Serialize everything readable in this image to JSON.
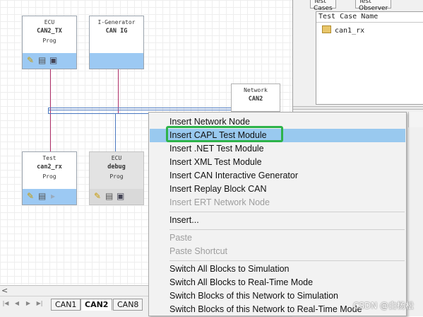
{
  "blocks": {
    "ecu_can2_tx": {
      "type": "ECU",
      "name": "CAN2_TX",
      "mode": "Prog"
    },
    "igen_can": {
      "type": "I-Generator",
      "name": "CAN IG"
    },
    "network_can2": {
      "type": "Network",
      "name": "CAN2",
      "extra": "CAN 2"
    },
    "test_can2_rx": {
      "type": "Test",
      "name": "can2_rx",
      "mode": "Prog"
    },
    "ecu_debug": {
      "type": "ECU",
      "name": "debug",
      "mode": "Prog"
    }
  },
  "right_pane": {
    "tabs": [
      "Test Cases",
      "Test Observer"
    ],
    "list_header": "Test Case Name",
    "list_items": [
      "can1_rx"
    ]
  },
  "network_tabs": [
    "CAN1",
    "CAN2",
    "CAN8"
  ],
  "active_network_tab": "CAN2",
  "context_menu": {
    "items": [
      {
        "label": "Insert Network Node",
        "enabled": true,
        "highlighted": false
      },
      {
        "label": "Insert CAPL Test Module",
        "enabled": true,
        "highlighted": true
      },
      {
        "label": "Insert .NET Test Module",
        "enabled": true,
        "highlighted": false
      },
      {
        "label": "Insert XML Test Module",
        "enabled": true,
        "highlighted": false
      },
      {
        "label": "Insert CAN Interactive Generator",
        "enabled": true,
        "highlighted": false
      },
      {
        "label": "Insert Replay Block CAN",
        "enabled": true,
        "highlighted": false
      },
      {
        "label": "Insert ERT Network Node",
        "enabled": false,
        "highlighted": false
      },
      {
        "label": "Insert...",
        "enabled": true,
        "highlighted": false
      },
      {
        "label": "Paste",
        "enabled": false,
        "highlighted": false
      },
      {
        "label": "Paste Shortcut",
        "enabled": false,
        "highlighted": false
      },
      {
        "label": "Switch All Blocks to Simulation",
        "enabled": true,
        "highlighted": false
      },
      {
        "label": "Switch All Blocks to Real-Time Mode",
        "enabled": true,
        "highlighted": false
      },
      {
        "label": "Switch Blocks of this Network to Simulation",
        "enabled": true,
        "highlighted": false
      },
      {
        "label": "Switch Blocks of this Network to Real-Time Mode",
        "enabled": true,
        "highlighted": false
      }
    ]
  },
  "watermark": "CSDN @白杨松",
  "colors": {
    "highlight": "#99c9ef",
    "annotation_box": "#2db34a",
    "block_bar": "#9cc9f3",
    "bus_line": "#4a78c0",
    "node_line": "#b0306a"
  },
  "icons": [
    "pencil-icon",
    "book-icon",
    "computer-icon",
    "arrow-icon",
    "folder-icon",
    "scroll-left-icon"
  ]
}
